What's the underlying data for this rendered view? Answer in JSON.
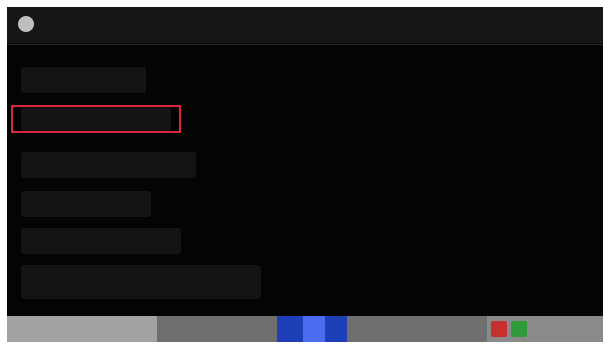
{
  "app": {
    "title": "",
    "icon": "app-icon"
  },
  "menu": {
    "selected_index": 1,
    "selection_color": "#d8263a",
    "items": [
      {
        "label": ""
      },
      {
        "label": ""
      },
      {
        "label": ""
      },
      {
        "label": ""
      },
      {
        "label": ""
      },
      {
        "label": ""
      }
    ]
  },
  "bottom_bar": {
    "label": "",
    "accent_color": "#1f3fb8"
  },
  "caption": ""
}
